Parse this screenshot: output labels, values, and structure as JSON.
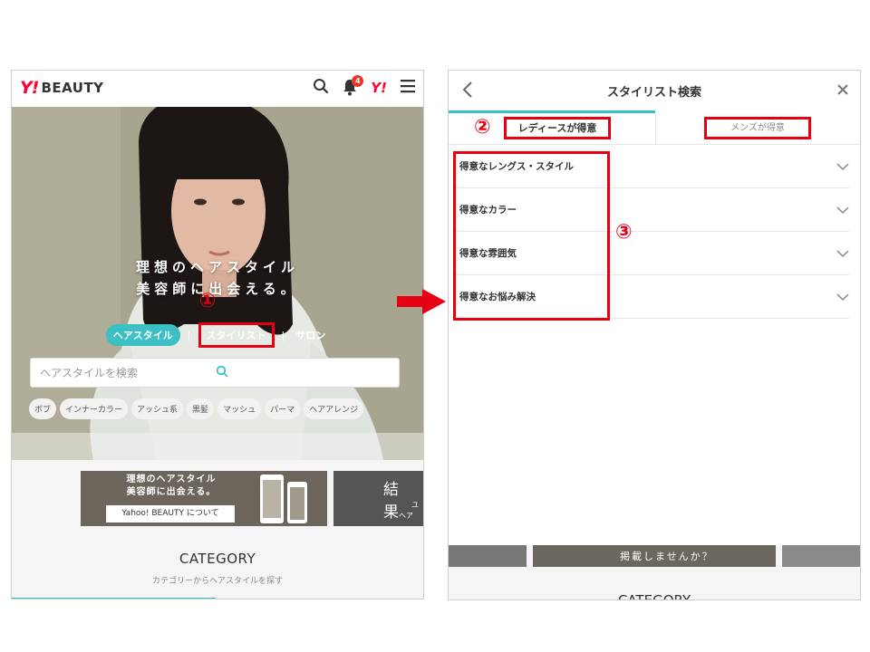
{
  "left": {
    "logo_y": "Y!",
    "logo_text": "BEAUTY",
    "notification_count": "4",
    "yahoo_mark": "Y!",
    "hero_line1": "理想のヘアスタイル",
    "hero_line2": "美容師に出会える。",
    "marker1": "①",
    "tabs": [
      "ヘアスタイル",
      "スタイリスト",
      "サロン"
    ],
    "tab_separator": "|",
    "search_placeholder": "ヘアスタイルを検索",
    "chips": [
      "ボブ",
      "インナーカラー",
      "アッシュ系",
      "黒髪",
      "マッシュ",
      "パーマ",
      "ヘアアレンジ"
    ],
    "banner_line1": "理想のヘアスタイル",
    "banner_line2": "美容師に出会える。",
    "banner_button": "Yahoo! BEAUTY について",
    "banner2_big": "結 果",
    "banner2_small1": "ユ",
    "banner2_small2": "ヘア",
    "category_title": "CATEGORY",
    "category_sub": "カテゴリーからヘアスタイルを探す"
  },
  "right": {
    "title": "スタイリスト検索",
    "marker2": "②",
    "tab_ladies": "レディースが得意",
    "tab_mens": "メンズが得意",
    "rows": [
      "得意なレングス・スタイル",
      "得意なカラー",
      "得意な雰囲気",
      "得意なお悩み解決"
    ],
    "marker3": "③",
    "bottom_banner_text": "掲載しませんか？",
    "category_title": "CATEGORY"
  },
  "colors": {
    "accent": "#3cc0c4",
    "highlight": "#e60012",
    "brand": "#ff0033"
  }
}
